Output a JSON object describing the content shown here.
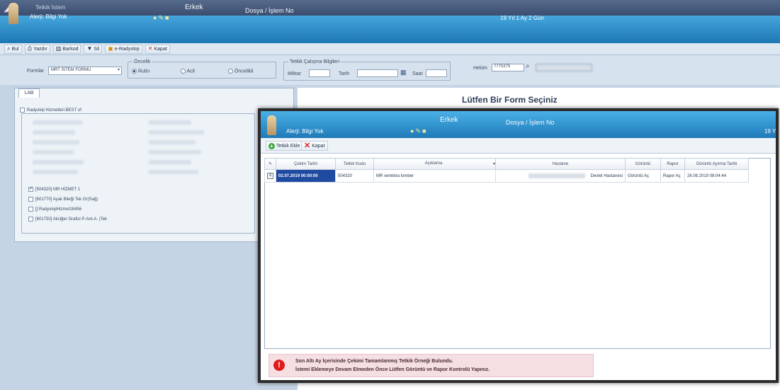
{
  "window": {
    "title": "Tetkik İstem"
  },
  "patient": {
    "allergy": "Alerji: Bilgi Yok",
    "gender": "Erkek",
    "file_label": "Dosya / İşlem No",
    "age": "19 Yıl 1 Ay 2 Gün"
  },
  "toolbar": {
    "items": [
      {
        "label": "Bul",
        "icon": "search-icon"
      },
      {
        "label": "Yazdır",
        "icon": "print-icon"
      },
      {
        "label": "Barkod",
        "icon": "barcode-icon"
      },
      {
        "label": "Sil",
        "icon": "filter-icon"
      },
      {
        "label": "e-Radyoloji",
        "icon": "radiology-icon"
      },
      {
        "label": "Kapat",
        "icon": "close-icon"
      }
    ]
  },
  "filters": {
    "forms_label": "Formlar",
    "forms_value": "MRT İSTEM FORMU",
    "priority_group": "Öncelik",
    "priorities": [
      "Rutin",
      "Acil",
      "Öncelikli"
    ],
    "work_group": "Tetkik Çalışma Bilgileri",
    "amount_label": "Miktar",
    "date_label": "Tarih",
    "time_label": "Saat",
    "doctor_label": "Hekim",
    "doctor_code": "7775275"
  },
  "left_panel": {
    "tab": "LAB",
    "group_title": "Radyoloji Hizmetleri BEST of",
    "items": [
      {
        "label": "[504320] MR HİZMET 1",
        "checked": true
      },
      {
        "label": "[601770] Ayak Bileği Tek Gr(Sağ)",
        "checked": false
      },
      {
        "label": "[] RadyolojiHizmet18456",
        "checked": false
      },
      {
        "label": "[601750] Akciğer Grafisi P-Ant-A. (Tek",
        "checked": false
      }
    ]
  },
  "main": {
    "form_title": "Lütfen Bir Form Seçiniz"
  },
  "modal": {
    "allergy": "Alerji: Bilgi Yok",
    "gender": "Erkek",
    "file_label": "Dosya / İşlem No",
    "age": "19 Y",
    "add_label": "Tetkik Ekle",
    "close_label": "Kapat",
    "columns": [
      "Çekim Tarihi",
      "Tetkik Kodu",
      "Açıklama",
      "Hastane",
      "Görüntü",
      "Rapor",
      "Görüntü Ayırma Tarihi"
    ],
    "rows": [
      {
        "date": "02.07.2019 00:00:00",
        "code": "504320",
        "desc": "MR vertebra lomber",
        "hospital": "Devlet Hastanesi",
        "image": "Görüntü Aç",
        "report": "Rapor Aç",
        "split_date": "26.08.2019 08:04:44"
      }
    ],
    "warning": {
      "line1": "Son Altı Ay İçerisinde Çekimi Tamamlanmış Tetkik Örneği Bulundu.",
      "line2": "İstemi Eklemeye Devam Etmeden Önce Lütfen Görüntü ve Rapor Kontrolü Yapınız."
    }
  }
}
